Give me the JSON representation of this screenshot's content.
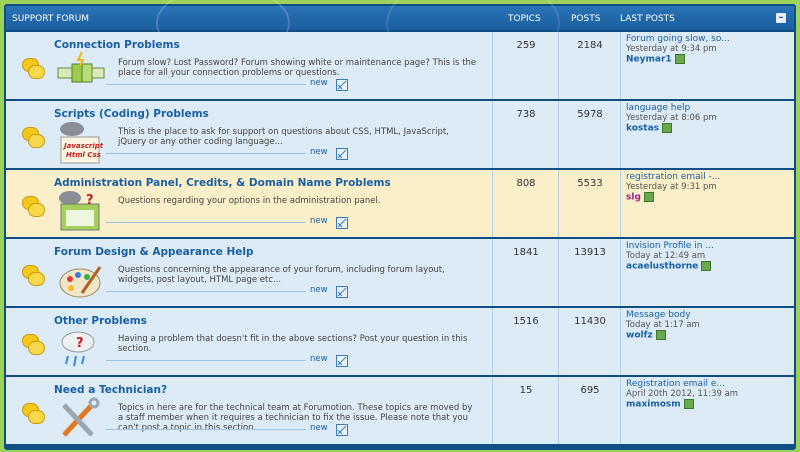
{
  "header": {
    "section": "SUPPORT FORUM",
    "topics": "TOPICS",
    "posts": "POSTS",
    "last_posts": "LAST POSTS"
  },
  "forums": [
    {
      "title": "Connection Problems",
      "desc": "Forum slow? Lost Password? Forum showing white or maintenance page? This is the place for all your connection problems or questions.",
      "topics": "259",
      "posts": "2184",
      "last_title": "Forum going slow, so...",
      "last_time": "Yesterday at 9:34 pm",
      "last_user": "Neymar1",
      "user_color": "#1a5fa3",
      "new": "new",
      "icon": "plug-icon",
      "highlight": false
    },
    {
      "title": "Scripts (Coding) Problems",
      "desc": "This is the place to ask for support on questions about CSS, HTML, JavaScript, jQuery or any other coding language...",
      "topics": "738",
      "posts": "5978",
      "last_title": "language help",
      "last_time": "Yesterday at 8:06 pm",
      "last_user": "kostas",
      "user_color": "#1a5fa3",
      "new": "new",
      "icon": "code-book-icon",
      "highlight": false
    },
    {
      "title": "Administration Panel, Credits, & Domain Name Problems",
      "desc": "Questions regarding your options in the administration panel.",
      "topics": "808",
      "posts": "5533",
      "last_title": "registration email -...",
      "last_time": "Yesterday at 9:31 pm",
      "last_user": "slg",
      "user_color": "#a0228a",
      "new": "new",
      "icon": "admin-panel-icon",
      "highlight": true
    },
    {
      "title": "Forum Design & Appearance Help",
      "desc": "Questions concerning the appearance of your forum, including forum layout, widgets, post layout, HTML page etc...",
      "topics": "1841",
      "posts": "13913",
      "last_title": "Invision Profile in ...",
      "last_time": "Today at 12:49 am",
      "last_user": "acaelusthorne",
      "user_color": "#1a5fa3",
      "new": "new",
      "icon": "palette-icon",
      "highlight": false
    },
    {
      "title": "Other Problems",
      "desc": "Having a problem that doesn't fit in the above sections? Post your question in this section.",
      "topics": "1516",
      "posts": "11430",
      "last_title": "Message body",
      "last_time": "Today at 1:17 am",
      "last_user": "wolfz",
      "user_color": "#1a5fa3",
      "new": "new",
      "icon": "question-cloud-icon",
      "highlight": false
    },
    {
      "title": "Need a Technician?",
      "desc": "Topics in here are for the technical team at Forumotion. These topics are moved by a staff member when it requires a technician to fix the issue. Please note that you can't post a topic in this section.",
      "topics": "15",
      "posts": "695",
      "last_title": "Registration email e...",
      "last_time": "April 20th 2012, 11:39 am",
      "last_user": "maximosm",
      "user_color": "#1a5fa3",
      "new": "new",
      "icon": "tools-icon",
      "highlight": false
    }
  ]
}
